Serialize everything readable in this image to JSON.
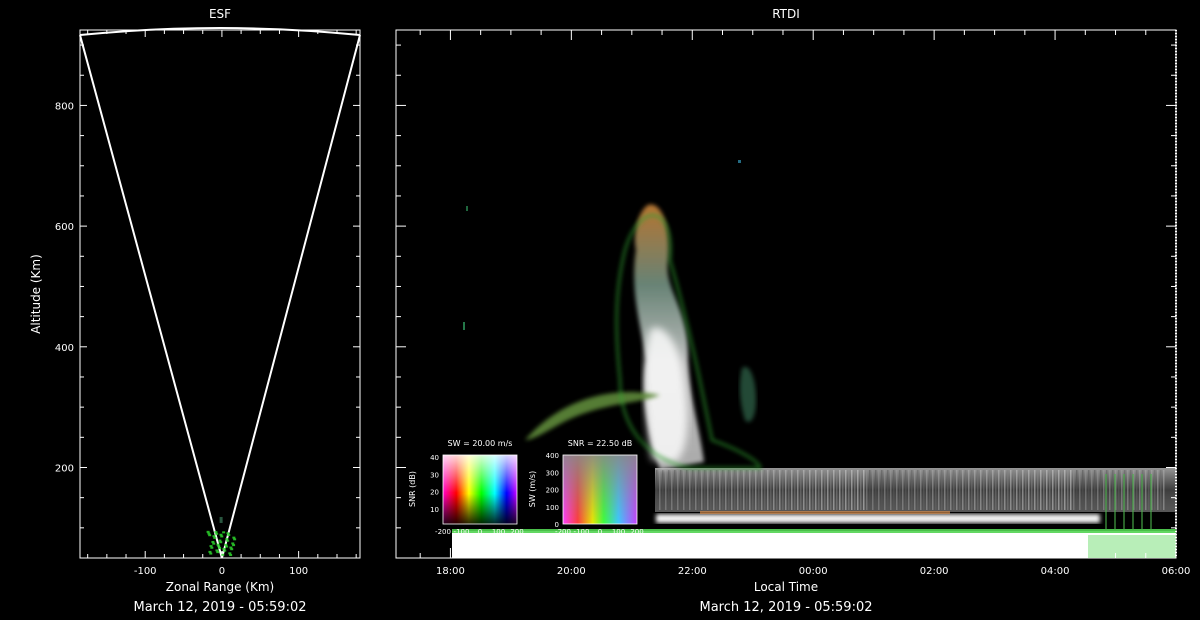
{
  "chart_data": [
    {
      "type": "fan-range-map",
      "title": "ESF",
      "xlabel": "Zonal Range (Km)",
      "ylabel": "Altitude (Km)",
      "date_caption": "March 12, 2019 - 05:59:02",
      "xlim": [
        -185,
        180
      ],
      "ylim": [
        50,
        925
      ],
      "x_ticks": [
        -100,
        0,
        100
      ],
      "y_ticks": [
        200,
        400,
        600,
        800
      ],
      "sector_edges_km": [
        [
          -185,
          910
        ],
        [
          180,
          910
        ],
        [
          0,
          50
        ]
      ],
      "echo_region": {
        "x_range": [
          -20,
          15
        ],
        "altitude_range": [
          55,
          95
        ],
        "color": "#2bd42b"
      }
    },
    {
      "type": "heatmap",
      "title": "RTDI",
      "xlabel": "Local Time",
      "date_caption": "March 12, 2019 - 05:59:02",
      "x_ticks": [
        "18:00",
        "20:00",
        "22:00",
        "00:00",
        "02:00",
        "04:00",
        "06:00"
      ],
      "xlim_hours": [
        17.1,
        30.0
      ],
      "ylim": [
        50,
        925
      ],
      "y_ticks": [
        200,
        400,
        600,
        800
      ],
      "features": [
        {
          "name": "plume",
          "start_hour": 20.9,
          "end_hour": 22.2,
          "altitude_range": [
            130,
            660
          ]
        },
        {
          "name": "bottom-layer",
          "start_hour": 21.4,
          "end_hour": 30.0,
          "altitude_range": [
            110,
            150
          ]
        },
        {
          "name": "saturated-bottom",
          "start_hour": 17.1,
          "end_hour": 30.0,
          "altitude_range": [
            50,
            90
          ]
        }
      ],
      "legends": [
        {
          "title": "SW = 20.00 m/s",
          "ylabel": "SNR (dB)",
          "y_ticks": [
            "40",
            "30",
            "20",
            "10"
          ],
          "x_ticks": [
            "-200",
            "-100",
            "0",
            "100",
            "200"
          ]
        },
        {
          "title": "SNR = 22.50 dB",
          "ylabel": "SW (m/s)",
          "y_ticks": [
            "400",
            "300",
            "200",
            "100",
            "0"
          ],
          "x_ticks": [
            "-200",
            "-100",
            "0",
            "100",
            "200"
          ]
        }
      ]
    }
  ]
}
